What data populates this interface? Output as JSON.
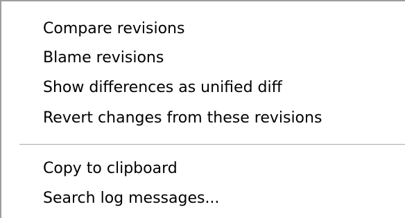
{
  "menu": {
    "items": [
      {
        "label": "Compare revisions"
      },
      {
        "label": "Blame revisions"
      },
      {
        "label": "Show differences as unified diff"
      },
      {
        "label": "Revert changes from these revisions"
      },
      {
        "label": "Copy to clipboard"
      },
      {
        "label": "Search log messages..."
      }
    ]
  }
}
